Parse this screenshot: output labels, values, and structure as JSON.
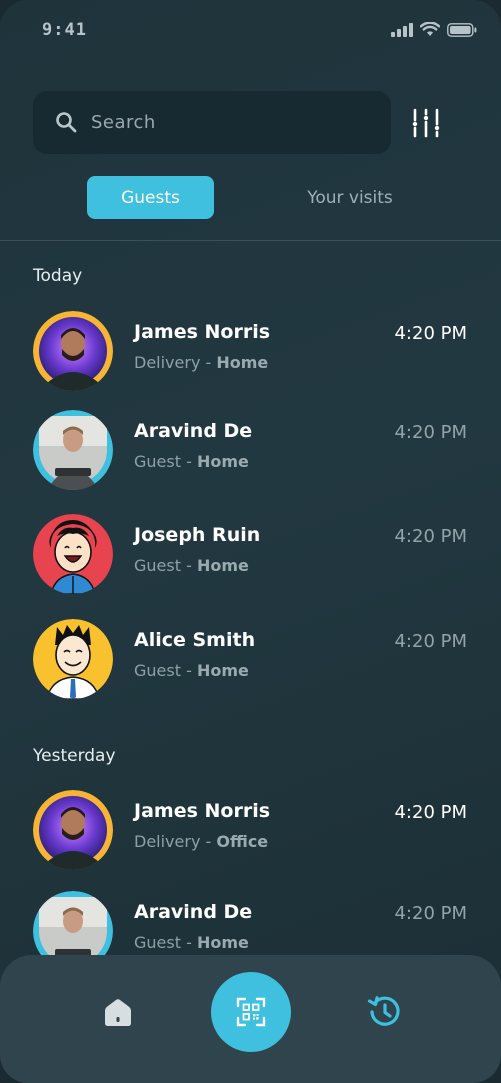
{
  "status_bar": {
    "time": "9:41"
  },
  "search": {
    "placeholder": "Search",
    "value": ""
  },
  "tabs": [
    {
      "label": "Guests",
      "active": true
    },
    {
      "label": "Your visits",
      "active": false
    }
  ],
  "sections": [
    {
      "label": "Today",
      "items": [
        {
          "name": "James Norris",
          "type": "Delivery",
          "separator": " - ",
          "place": "Home",
          "time": "4:20 PM",
          "avatar": "photo-man-beard-icon",
          "ring": "#f6b534",
          "time_emphasis": "bright"
        },
        {
          "name": "Aravind De",
          "type": "Guest",
          "separator": " - ",
          "place": "Home",
          "time": "4:20 PM",
          "avatar": "photo-man-laptop-icon",
          "ring": "#3ec0de",
          "time_emphasis": "dim"
        },
        {
          "name": "Joseph Ruin",
          "type": "Guest",
          "separator": " - ",
          "place": "Home",
          "time": "4:20 PM",
          "avatar": "cartoon-laughing-man-icon",
          "ring": "#e8444f",
          "time_emphasis": "dim"
        },
        {
          "name": "Alice Smith",
          "type": "Guest",
          "separator": " - ",
          "place": "Home",
          "time": "4:20 PM",
          "avatar": "cartoon-smiling-man-icon",
          "ring": "#f9c12e",
          "time_emphasis": "dim"
        }
      ]
    },
    {
      "label": "Yesterday",
      "items": [
        {
          "name": "James Norris",
          "type": "Delivery",
          "separator": " - ",
          "place": "Office",
          "time": "4:20 PM",
          "avatar": "photo-man-beard-icon",
          "ring": "#f6b534",
          "time_emphasis": "bright"
        },
        {
          "name": "Aravind De",
          "type": "Guest",
          "separator": " - ",
          "place": "Home",
          "time": "4:20 PM",
          "avatar": "photo-man-laptop-icon",
          "ring": "#3ec0de",
          "time_emphasis": "dim"
        }
      ]
    }
  ],
  "nav": {
    "items": [
      {
        "icon": "home-icon"
      },
      {
        "icon": "qr-scan-icon"
      },
      {
        "icon": "history-icon"
      }
    ]
  },
  "colors": {
    "accent": "#3ec0de",
    "background": "#213640",
    "nav_background": "#2f444d"
  }
}
